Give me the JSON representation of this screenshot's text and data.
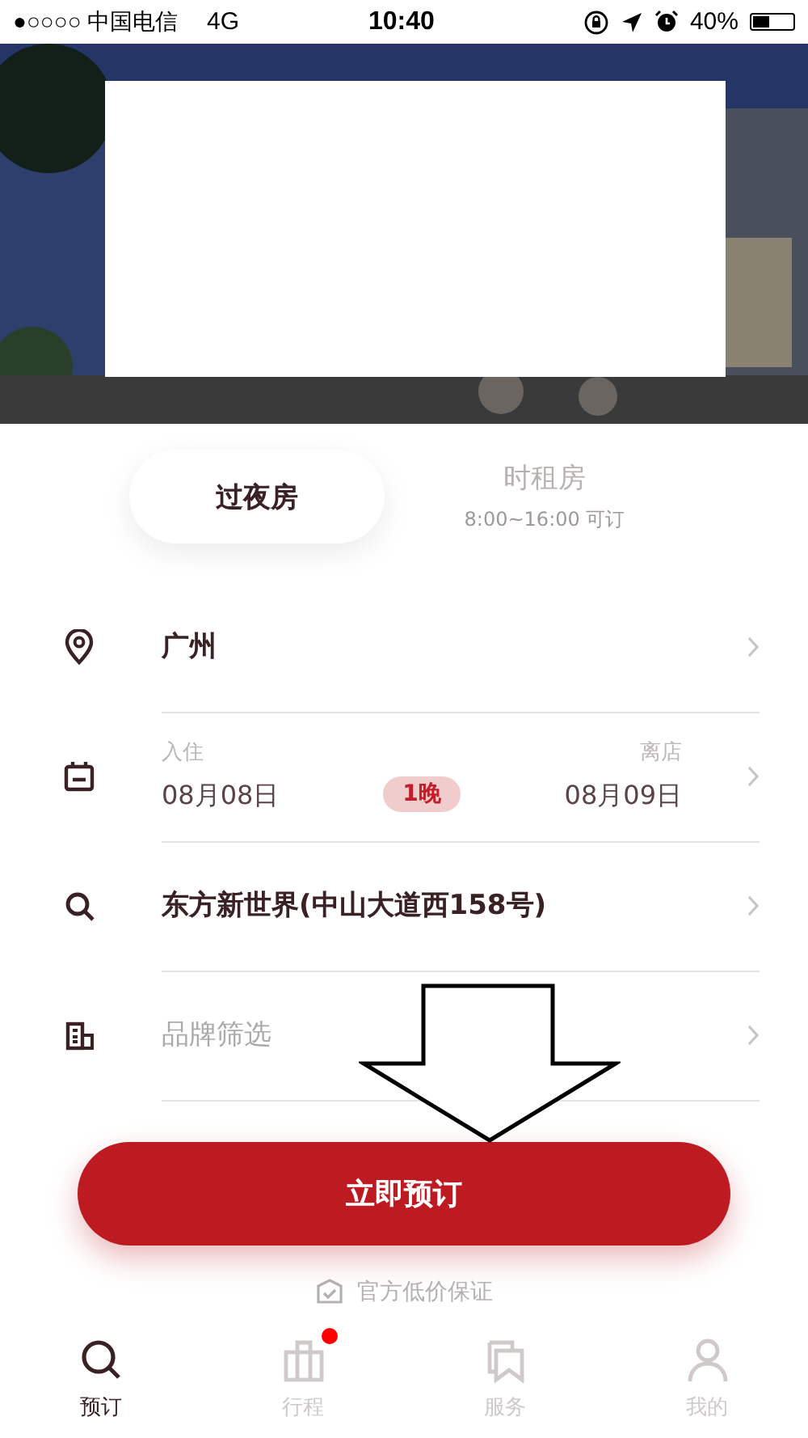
{
  "status_bar": {
    "carrier": "●○○○○ 中国电信",
    "network": "4G",
    "time": "10:40",
    "battery": "40%"
  },
  "room_tabs": [
    {
      "label": "过夜房",
      "selected": true
    },
    {
      "label": "时租房",
      "subtitle": "8:00~16:00 可订",
      "selected": false
    }
  ],
  "form_rows": [
    {
      "kind": "location",
      "value": "广州",
      "muted": false
    },
    {
      "kind": "dates",
      "checkin_label": "入住",
      "checkin": "08月08日",
      "nights": "1晚",
      "checkout_label": "离店",
      "checkout": "08月09日"
    },
    {
      "kind": "search",
      "value": "东方新世界(中山大道西158号)",
      "muted": false
    },
    {
      "kind": "brand",
      "value": "品牌筛选",
      "muted": true
    }
  ],
  "book_button": "立即预订",
  "guarantee": "官方低价保证",
  "bottom_nav": [
    {
      "label": "预订",
      "selected": true,
      "badge": false
    },
    {
      "label": "行程",
      "selected": false,
      "badge": true
    },
    {
      "label": "服务",
      "selected": false,
      "badge": false
    },
    {
      "label": "我的",
      "selected": false,
      "badge": false
    }
  ]
}
